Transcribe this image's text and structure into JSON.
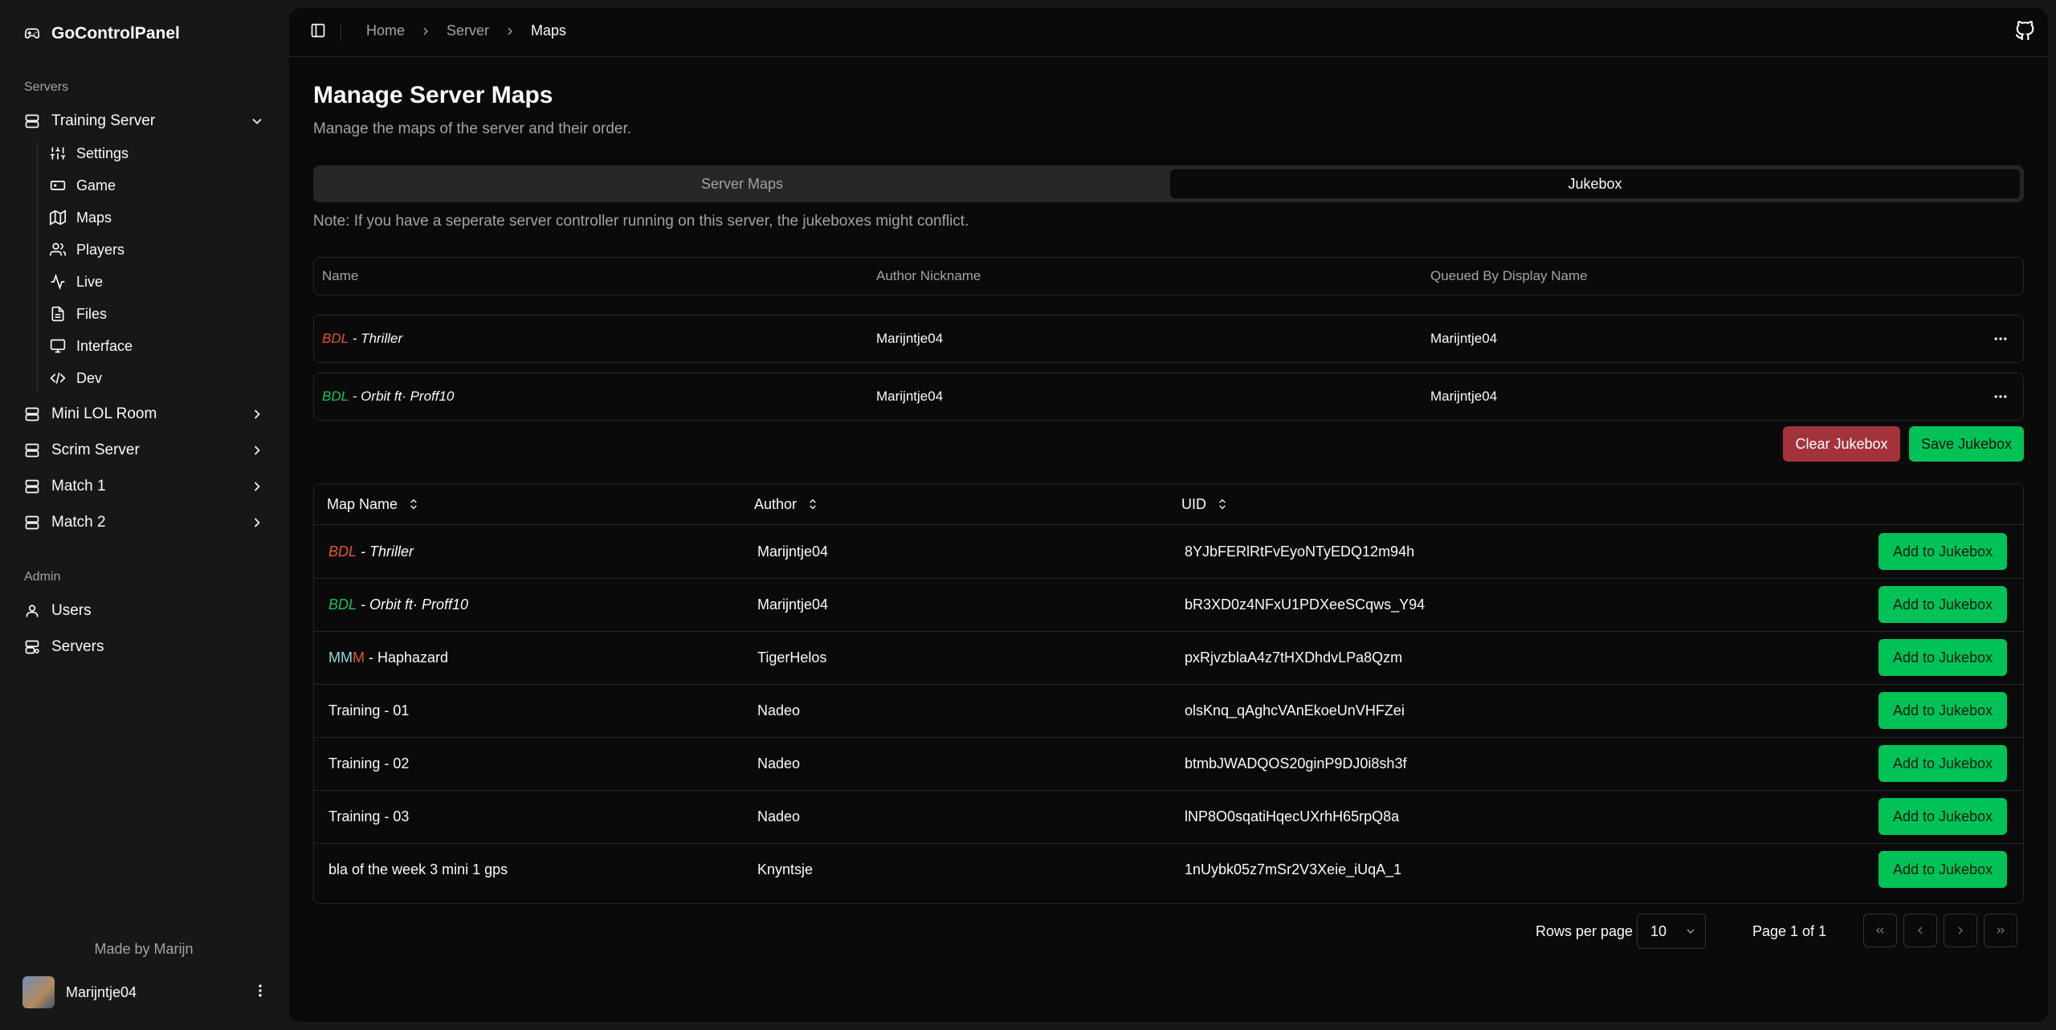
{
  "app": {
    "title": "GoControlPanel"
  },
  "sidebar": {
    "servers_label": "Servers",
    "servers": [
      {
        "label": "Training Server",
        "expanded": true
      },
      {
        "label": "Mini LOL Room"
      },
      {
        "label": "Scrim Server"
      },
      {
        "label": "Match 1"
      },
      {
        "label": "Match 2"
      }
    ],
    "sub_items": [
      {
        "label": "Settings",
        "icon": "sliders-icon"
      },
      {
        "label": "Game",
        "icon": "gamepad-icon"
      },
      {
        "label": "Maps",
        "icon": "map-icon"
      },
      {
        "label": "Players",
        "icon": "users-icon"
      },
      {
        "label": "Live",
        "icon": "activity-icon"
      },
      {
        "label": "Files",
        "icon": "file-icon"
      },
      {
        "label": "Interface",
        "icon": "monitor-icon"
      },
      {
        "label": "Dev",
        "icon": "code-icon"
      }
    ],
    "admin_label": "Admin",
    "admin_items": [
      {
        "label": "Users",
        "icon": "user-icon"
      },
      {
        "label": "Servers",
        "icon": "server-icon"
      }
    ],
    "made_by": "Made by Marijn",
    "user": {
      "name": "Marijntje04"
    }
  },
  "breadcrumb": [
    "Home",
    "Server",
    "Maps"
  ],
  "page": {
    "title": "Manage Server Maps",
    "description": "Manage the maps of the server and their order."
  },
  "tabs": [
    {
      "label": "Server Maps",
      "active": false
    },
    {
      "label": "Jukebox",
      "active": true
    }
  ],
  "note": "Note: If you have a seperate server controller running on this server, the jukeboxes might conflict.",
  "jukebox": {
    "headers": [
      "Name",
      "Author Nickname",
      "Queued By Display Name"
    ],
    "rows": [
      {
        "name_prefix": "BDL",
        "name_rest": " - Thriller",
        "author": "Marijntje04",
        "queued_by": "Marijntje04"
      },
      {
        "name_prefix": "BDL",
        "name_rest": " - Orbit ft· Proff10",
        "author": "Marijntje04",
        "queued_by": "Marijntje04"
      }
    ],
    "clear_label": "Clear Jukebox",
    "save_label": "Save Jukebox"
  },
  "maps_table": {
    "headers": [
      "Map Name",
      "Author",
      "UID"
    ],
    "add_label": "Add to Jukebox",
    "rows": [
      {
        "name_a": "BDL",
        "name_b": "",
        "name_rest": " - Thriller",
        "author": "Marijntje04",
        "uid": "8YJbFERlRtFvEyoNTyEDQ12m94h"
      },
      {
        "name_a": "BDL",
        "name_b": "",
        "name_rest": " - Orbit ft· Proff10",
        "author": "Marijntje04",
        "uid": "bR3XD0z4NFxU1PDXeeSCqws_Y94"
      },
      {
        "name_a": "MM",
        "name_b": "M",
        "name_rest": " - Haphazard",
        "author": "TigerHelos",
        "uid": "pxRjvzblaA4z7tHXDhdvLPa8Qzm"
      },
      {
        "name_a": "",
        "name_b": "",
        "name_rest": "Training - 01",
        "author": "Nadeo",
        "uid": "olsKnq_qAghcVAnEkoeUnVHFZei"
      },
      {
        "name_a": "",
        "name_b": "",
        "name_rest": "Training - 02",
        "author": "Nadeo",
        "uid": "btmbJWADQOS20ginP9DJ0i8sh3f"
      },
      {
        "name_a": "",
        "name_b": "",
        "name_rest": "Training - 03",
        "author": "Nadeo",
        "uid": "lNP8O0sqatiHqecUXrhH65rpQ8a"
      },
      {
        "name_a": "",
        "name_b": "",
        "name_rest": "bla of the week 3 mini 1 gps",
        "author": "Knyntsje",
        "uid": "1nUybk05z7mSr2V3Xeie_iUqA_1"
      }
    ]
  },
  "pagination": {
    "rows_per_page_label": "Rows per page",
    "rows_per_page": "10",
    "page_info": "Page 1 of 1"
  },
  "colors": {
    "accent_green": "#00c257",
    "danger_red": "#a3333b",
    "background": "#0a0a0a",
    "sidebar": "#171717"
  }
}
